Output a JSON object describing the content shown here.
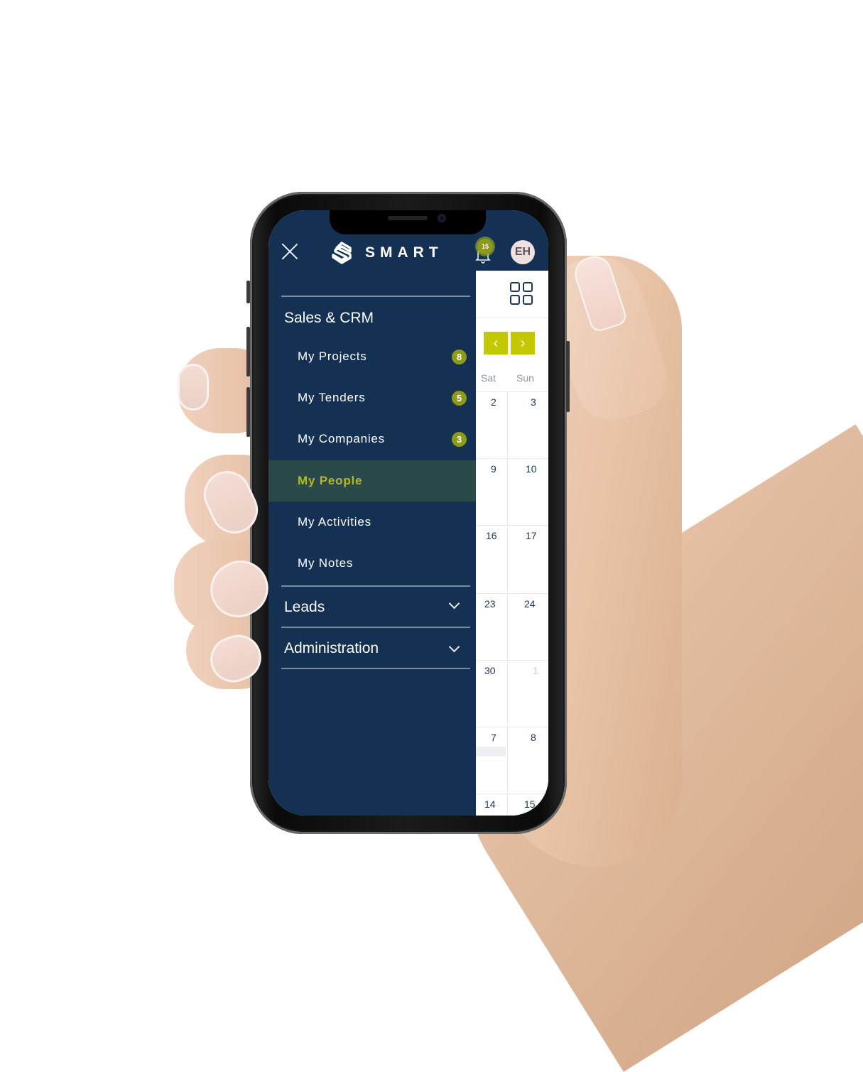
{
  "app": {
    "brand": "SMART",
    "notifications_count": "15",
    "user_initials": "EH"
  },
  "colors": {
    "drawer_bg": "#143154",
    "accent": "#c3c800",
    "badge": "#8e9b1a",
    "active_text": "#b6b91c"
  },
  "icons": {
    "close": "close-icon",
    "logo": "smart-logo-icon",
    "notifications": "bell-icon",
    "grid": "grid-view-icon",
    "prev": "chevron-left-icon",
    "next": "chevron-right-icon",
    "expand": "chevron-down-icon"
  },
  "drawer": {
    "section_title": "Sales & CRM",
    "items": [
      {
        "label": "My Projects",
        "badge": "8",
        "active": false
      },
      {
        "label": "My Tenders",
        "badge": "5",
        "active": false
      },
      {
        "label": "My Companies",
        "badge": "3",
        "active": false
      },
      {
        "label": "My People",
        "badge": null,
        "active": true
      },
      {
        "label": "My Activities",
        "badge": null,
        "active": false
      },
      {
        "label": "My Notes",
        "badge": null,
        "active": false
      }
    ],
    "collapsed_sections": [
      {
        "label": "Leads"
      },
      {
        "label": "Administration"
      }
    ]
  },
  "calendar": {
    "prev_label": "‹",
    "next_label": "›",
    "weekdays": [
      "Sat",
      "Sun"
    ],
    "weeks": [
      [
        "2",
        "3"
      ],
      [
        "9",
        "10"
      ],
      [
        "16",
        "17"
      ],
      [
        "23",
        "24"
      ],
      [
        "30",
        "1"
      ],
      [
        "7",
        "8"
      ],
      [
        "14",
        "15"
      ]
    ]
  }
}
